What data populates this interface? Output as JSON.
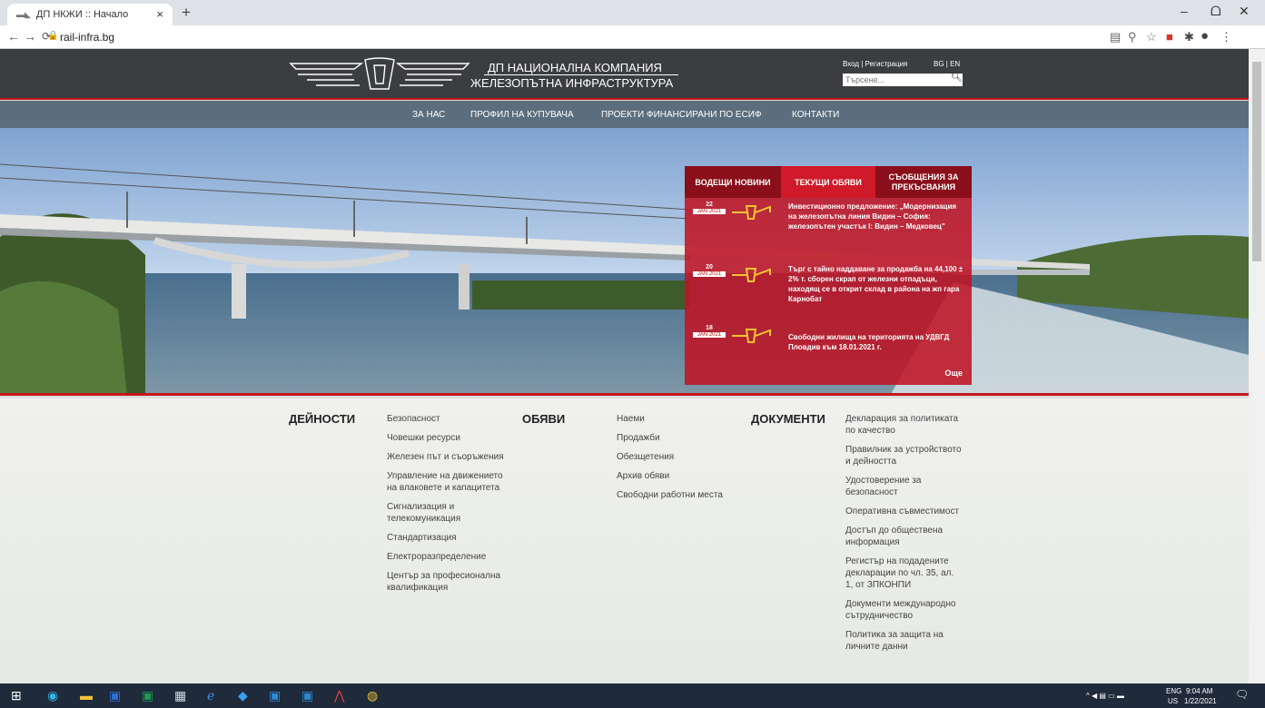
{
  "browser": {
    "tab_title": "ДП НКЖИ :: Начало",
    "tab_close": "×",
    "new_tab": "+",
    "url": "rail-infra.bg",
    "win_min": "–",
    "win_max": "ᗝ",
    "win_close": "✕"
  },
  "header": {
    "brand_line1": "ДП НАЦИОНАЛНА КОМПАНИЯ",
    "brand_line2": "ЖЕЛЕЗОПЪТНА ИНФРАСТРУКТУРА",
    "login": "Вход  |  Регистрация",
    "lang": "BG  |  EN",
    "search_placeholder": "Търсене..."
  },
  "nav": [
    "ЗА НАС",
    "ПРОФИЛ НА КУПУВАЧА",
    "ПРОЕКТИ ФИНАНСИРАНИ ПО ЕСИФ",
    "КОНТАКТИ"
  ],
  "news": {
    "tabs": [
      "ВОДЕЩИ НОВИНИ",
      "ТЕКУЩИ ОБЯВИ",
      "СЪОБЩЕНИЯ ЗА ПРЕКЪСВАНИЯ"
    ],
    "items": [
      {
        "day": "22",
        "mon": "JAN 2021",
        "text": "Инвестиционно предложение: „Модернизация на железопътна линия Видин – София: железопътен участък I: Видин – Медковец\""
      },
      {
        "day": "20",
        "mon": "JAN 2021",
        "text": "Търг с тайно наддаване за продажба на 44,100 ± 2% т. сборен скрап от железни отпадъци, находящ се в открит склад в района на жп гара Карнобат"
      },
      {
        "day": "18",
        "mon": "JAN 2021",
        "text": "Свободни жилища на територията на УДВГД Пловдив към 18.01.2021 г."
      }
    ],
    "more": "Още"
  },
  "footer": {
    "activities_title": "ДЕЙНОСТИ",
    "activities": [
      "Безопасност",
      "Човешки ресурси",
      "Железен път и съоръжения",
      "Управление на движението на влаковете и капацитета",
      "Сигнализация и телекомуникация",
      "Стандартизация",
      "Електроразпределение",
      "Център за професионална квалификация"
    ],
    "ads_title": "ОБЯВИ",
    "ads": [
      "Наеми",
      "Продажби",
      "Обезщетения",
      "Архив обяви",
      "Свободни работни места"
    ],
    "docs_title": "ДОКУМЕНТИ",
    "docs": [
      "Декларация за политиката по качество",
      "Правилник за устройството и дейността",
      "Удостоверение за безопасност",
      "Оперативна съвместимост",
      "Достъп до обществена информация",
      "Регистър на подадените декларации по чл. 35, ал. 1, от ЗПКОНПИ",
      "Документи международно сътрудничество",
      "Политика за защита на личните данни"
    ]
  },
  "taskbar": {
    "lang1": "ENG",
    "lang2": "US",
    "time": "9:04 AM",
    "date": "1/22/2021"
  },
  "colors": {
    "accent_red": "#c4161c",
    "header_bg": "#3b3d40",
    "nav_bg": "#5c6e7e"
  }
}
